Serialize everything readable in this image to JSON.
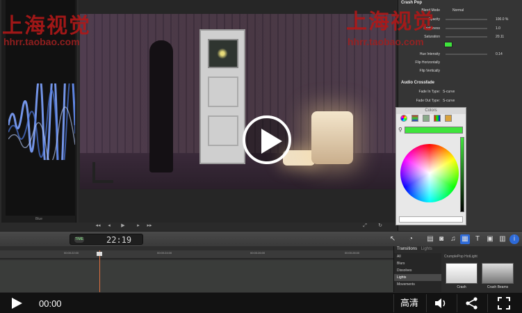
{
  "watermark": {
    "text_left": "上海视觉",
    "text_right": "上海视觉",
    "url_left": "hhrr.taobao.com",
    "url_right": "hhrr.taobao.com"
  },
  "scope": {
    "label": "Blue"
  },
  "inspector": {
    "effect_title": "Crash Pop",
    "rows": [
      {
        "label": "Blend Mode",
        "value": "Normal"
      },
      {
        "label": "Opacity",
        "value": "100.0 %"
      },
      {
        "label": "Brightness",
        "value": "1.0"
      },
      {
        "label": "Saturation",
        "value": "20.11"
      },
      {
        "label": "Color",
        "value": ""
      },
      {
        "label": "Hue Intensity",
        "value": "0.14"
      },
      {
        "label": "Flip Horizontally",
        "value": ""
      },
      {
        "label": "Flip Vertically",
        "value": ""
      }
    ],
    "audio_title": "Audio Crossfade",
    "fade_in_label": "Fade In Type:",
    "fade_in_value": "S-curve",
    "fade_out_label": "Fade Out Type:",
    "fade_out_value": "S-curve"
  },
  "colors_window": {
    "title": "Colors",
    "selected_color": "#3fe43c"
  },
  "toolbar": {
    "timecode": "22:19",
    "timecode_badge": "TIME"
  },
  "timeline": {
    "ruler_labels": [
      "00:00:22:00",
      "00:00:24:00",
      "00:00:26:00",
      "00:00:28:00"
    ],
    "playhead_color": "#e07040"
  },
  "browser": {
    "header": "Transitions",
    "header_sub": "Lights",
    "categories": [
      "All",
      "Blurs",
      "Dissolves",
      "Lights",
      "Movements"
    ],
    "selected_category": "Lights",
    "pack_label": "CrumplePop HotLight",
    "thumbs": [
      "Crash",
      "Crash Beams"
    ]
  },
  "player": {
    "time": "00:00",
    "quality": "高清",
    "icons": [
      "play-icon",
      "volume-icon",
      "share-icon",
      "fullscreen-icon"
    ]
  }
}
